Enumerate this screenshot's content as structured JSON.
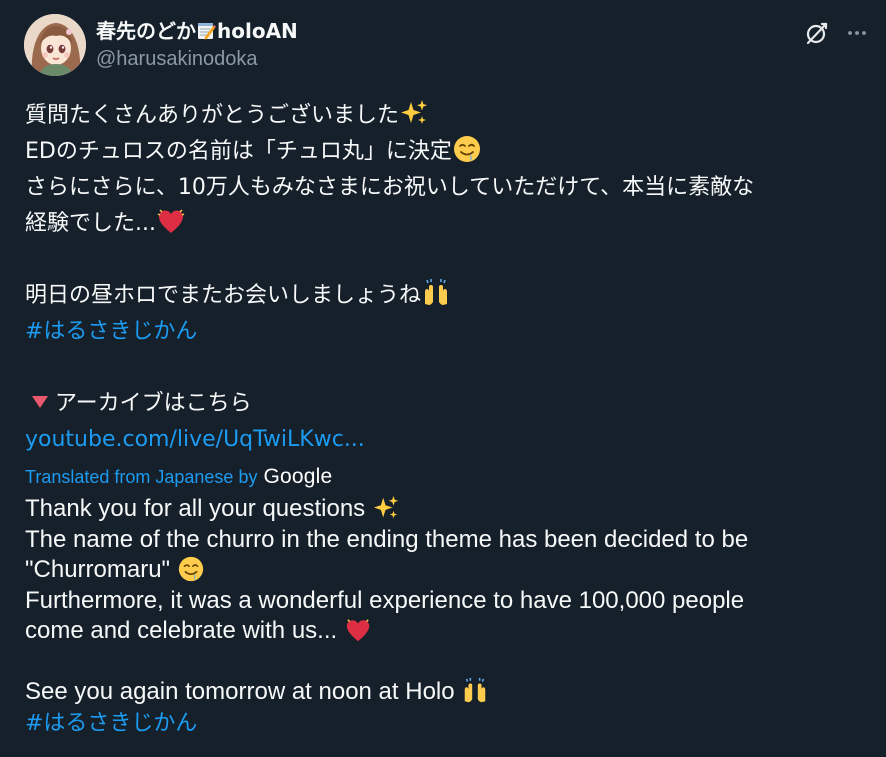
{
  "author": {
    "display_name": "春先のどか",
    "display_name_suffix": "holoAN",
    "display_name_emoji": "memo-icon",
    "handle": "@harusakinodoka"
  },
  "header_actions": {
    "grok_icon": "grok-icon",
    "more_icon": "more-icon"
  },
  "tweet": {
    "l1": "質問たくさんありがとうございました",
    "l2": "EDのチュロスの名前は「チュロ丸」に決定",
    "l3": "さらにさらに、10万人もみなさまにお祝いしていただけて、本当に素敵な",
    "l4": "経験でした...",
    "l5": "明日の昼ホロでまたお会いしましょうね",
    "hashtag": "#はるさきじかん",
    "l7": "アーカイブはこちら",
    "link": "youtube.com/live/UqTwiLKwc..."
  },
  "translation": {
    "label": "Translated from Japanese by",
    "provider": "Google",
    "t1": "Thank you for all your questions",
    "t2": "The name of the churro in the ending theme has been decided to be",
    "t3": "\"Churromaru\"",
    "t4": "Furthermore, it was a wonderful experience to have 100,000 people",
    "t5": "come and celebrate with us...",
    "t6": "See you again tomorrow at noon at Holo",
    "hashtag": "#はるさきじかん"
  },
  "colors": {
    "background": "#15202b",
    "text": "#f7f9f9",
    "secondary": "#8b98a5",
    "link": "#1d9bf0"
  }
}
